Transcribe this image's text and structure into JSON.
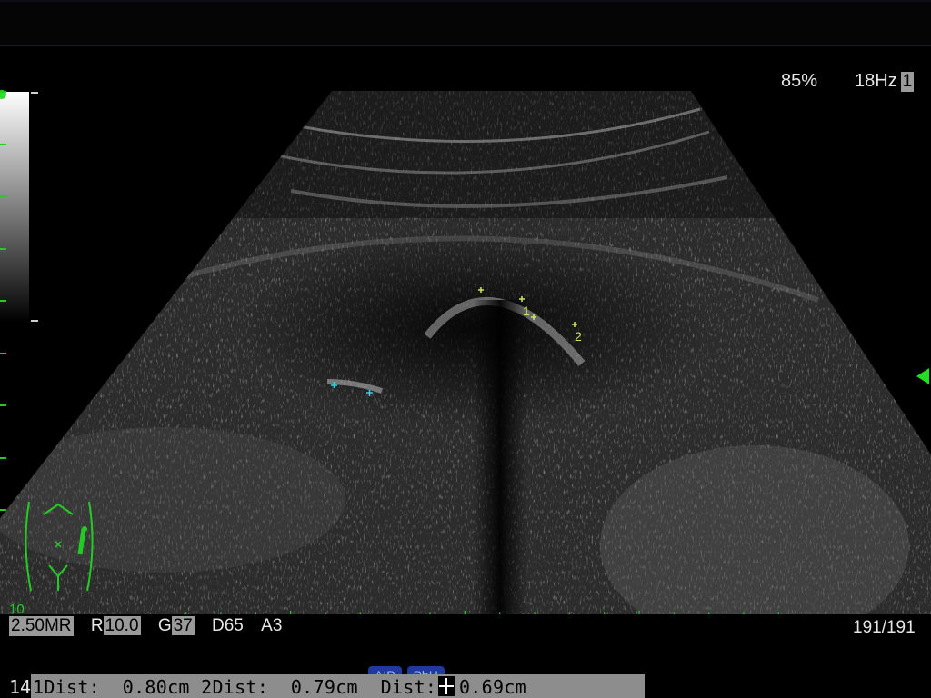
{
  "status": {
    "power": "85%",
    "framerate": "18Hz",
    "focus_count": "1"
  },
  "depth_label": "10",
  "params": [
    {
      "label": "2.50MR",
      "highlight": true
    },
    {
      "prefix": "R",
      "value": "10.0"
    },
    {
      "prefix": "G",
      "value": "37"
    },
    {
      "label": "D65"
    },
    {
      "label": "A3"
    }
  ],
  "frame_count": "191/191",
  "calipers": {
    "markers": [
      "1",
      "2"
    ]
  },
  "tabs": [
    "AIP",
    "PhH"
  ],
  "measurement": {
    "prefix": "14",
    "text": "1Dist:  0.80cm 2Dist:  0.79cm  Dist:  0.69cm"
  },
  "colors": {
    "overlay_green": "#22cc22",
    "caliper_yellow": "#c8e85a",
    "caliper_cyan": "#33d0e8",
    "highlight_gray": "#9a9a9a"
  },
  "icons": [
    "body-marker-icon",
    "focus-marker-icon",
    "cursor-icon"
  ]
}
